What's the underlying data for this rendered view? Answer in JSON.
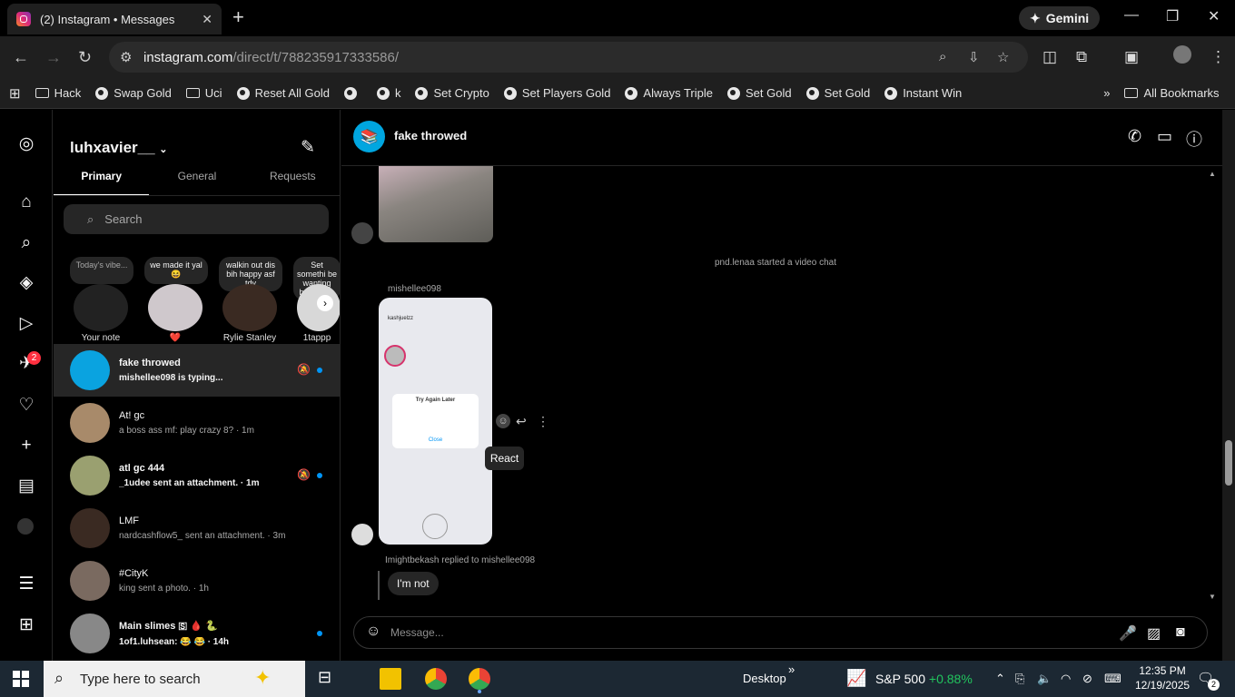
{
  "browser": {
    "tab_title": "(2) Instagram • Messages",
    "gemini_label": "Gemini",
    "url_host": "instagram.com",
    "url_path": "/direct/t/788235917333586/"
  },
  "bookmarks": [
    {
      "label": "Hack",
      "icon": "folder-icon"
    },
    {
      "label": "Swap Gold",
      "icon": "globe-icon"
    },
    {
      "label": "Uci",
      "icon": "folder-icon"
    },
    {
      "label": "Reset All Gold",
      "icon": "globe-icon"
    },
    {
      "label": "",
      "icon": "globe-icon"
    },
    {
      "label": "k",
      "icon": "globe-icon"
    },
    {
      "label": "Set Crypto",
      "icon": "globe-icon"
    },
    {
      "label": "Set Players Gold",
      "icon": "globe-icon"
    },
    {
      "label": "Always Triple",
      "icon": "globe-icon"
    },
    {
      "label": "Set Gold",
      "icon": "globe-icon"
    },
    {
      "label": "Set Gold",
      "icon": "globe-icon"
    },
    {
      "label": "Instant Win",
      "icon": "globe-icon"
    }
  ],
  "all_bookmarks_label": "All Bookmarks",
  "nav": {
    "notifications_badge": "2"
  },
  "inbox": {
    "username": "luhxavier__",
    "tabs": [
      "Primary",
      "General",
      "Requests"
    ],
    "search_placeholder": "Search",
    "notes": [
      {
        "bubble": "Today's vibe...",
        "label": "Your note"
      },
      {
        "bubble": "we made it yal 😆",
        "label": "❤️"
      },
      {
        "bubble": "walkin out dis bih happy asf tdy",
        "label": "Rylie Stanley"
      },
      {
        "bubble": "Set somethi be wanting bust my o",
        "label": "1tappp"
      }
    ],
    "threads": [
      {
        "name": "fake throwed",
        "preview": "mishellee098 is typing...",
        "bold": true,
        "muted": true,
        "unread": true
      },
      {
        "name": "At! gc",
        "preview": "a boss ass mf: play crazy 8? · 1m",
        "bold": false,
        "muted": false,
        "unread": false
      },
      {
        "name": "atl gc 444",
        "preview": "_1udee sent an attachment. · 1m",
        "bold": true,
        "muted": true,
        "unread": true
      },
      {
        "name": "LMF",
        "preview": "nardcashflow5_ sent an attachment. · 3m",
        "bold": false,
        "muted": false,
        "unread": false
      },
      {
        "name": "#CityK",
        "preview": "king sent a photo. · 1h",
        "bold": false,
        "muted": false,
        "unread": false
      },
      {
        "name": "Main slimes 🇸 🩸 🐍",
        "preview": "1of1.luhsean: 😂 😂 · 14h",
        "bold": true,
        "muted": false,
        "unread": true
      }
    ]
  },
  "chat": {
    "title": "fake throwed",
    "system_message": "pnd.lenaa started a video chat",
    "sender": "mishellee098",
    "screenshot_modal_title": "Try Again Later",
    "screenshot_modal_close": "Close",
    "screenshot_profile": "kashjuelzz",
    "tooltip": "React",
    "reply_meta": "Imightbekash replied to mishellee098",
    "reply_text": "I'm not",
    "composer_placeholder": "Message..."
  },
  "taskbar": {
    "search_placeholder": "Type here to search",
    "desktop_label": "Desktop",
    "stock_name": "S&P 500",
    "stock_change": "+0.88%",
    "time": "12:35 PM",
    "date": "12/19/2025",
    "notif_count": "2"
  },
  "colors": {
    "accent": "#0095f6",
    "badge": "#ff3040",
    "stock_up": "#22c55e"
  }
}
